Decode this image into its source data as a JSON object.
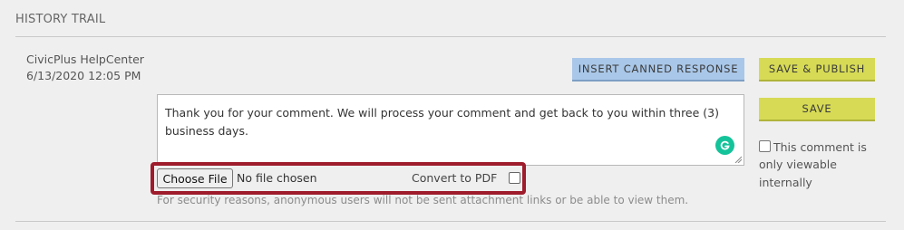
{
  "section": {
    "title": "HISTORY TRAIL"
  },
  "comment": {
    "author": "CivicPlus HelpCenter",
    "date": "6/13/2020 12:05 PM",
    "text": "Thank you for your comment. We will process your comment and get back to you within three (3) business days."
  },
  "buttons": {
    "canned": "INSERT CANNED RESPONSE",
    "save_publish": "SAVE & PUBLISH",
    "save": "SAVE"
  },
  "private_option": {
    "label": "This comment is only viewable internally",
    "checked": false
  },
  "attachment": {
    "choose_file": "Choose File",
    "status": "No file chosen",
    "convert_label": "Convert to PDF",
    "convert_checked": false,
    "note": "For security reasons, anonymous users will not be sent attachment links or be able to view them."
  },
  "colors": {
    "canned_button": "#a9c7e8",
    "save_buttons": "#d6da55",
    "highlight_border": "#9e1c2c",
    "grammarly": "#15c39a"
  },
  "icons": {
    "grammarly": "grammarly-icon",
    "resize": "resize-grip-icon"
  }
}
